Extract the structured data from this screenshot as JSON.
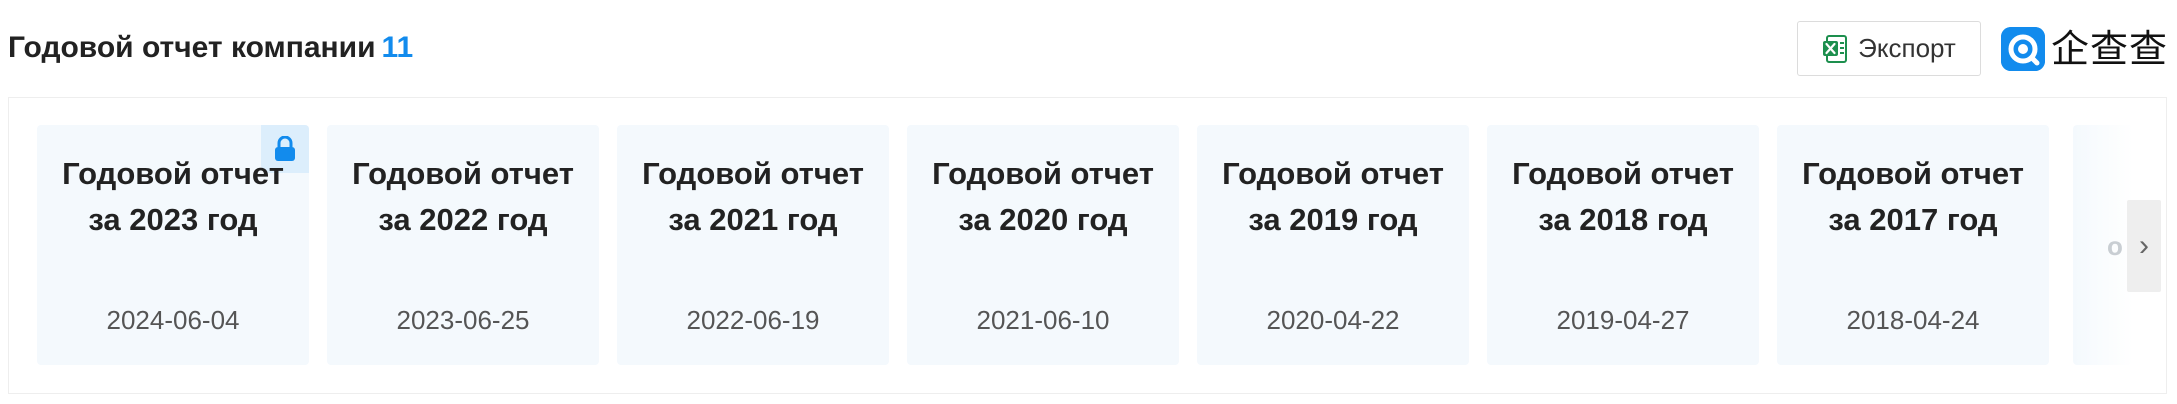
{
  "header": {
    "title": "Годовой отчет компании",
    "count": "11",
    "export_label": "Экспорт",
    "export_icon": "excel-icon",
    "logo_text": "企查查",
    "logo_icon": "qichacha-logo-icon"
  },
  "reports": [
    {
      "title": "Годовой отчет за 2023 год",
      "date": "2024-06-04",
      "locked": true
    },
    {
      "title": "Годовой отчет за 2022 год",
      "date": "2023-06-25",
      "locked": false
    },
    {
      "title": "Годовой отчет за 2021 год",
      "date": "2022-06-19",
      "locked": false
    },
    {
      "title": "Годовой отчет за 2020 год",
      "date": "2021-06-10",
      "locked": false
    },
    {
      "title": "Годовой отчет за 2019 год",
      "date": "2020-04-22",
      "locked": false
    },
    {
      "title": "Годовой отчет за 2018 год",
      "date": "2019-04-27",
      "locked": false
    },
    {
      "title": "Годовой отчет за 2017 год",
      "date": "2018-04-24",
      "locked": false
    }
  ],
  "partial_card_text": "о",
  "next_arrow": "›",
  "colors": {
    "accent": "#128bed",
    "card_bg": "#f4f9fd",
    "lock_badge_bg": "#dceefc"
  }
}
